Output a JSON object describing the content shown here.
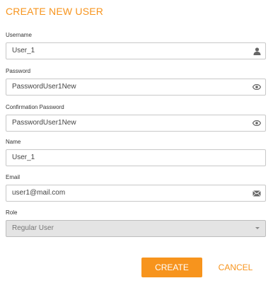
{
  "form": {
    "title": "CREATE NEW USER",
    "accent_color": "#f7941d",
    "fields": {
      "username": {
        "label": "Username",
        "value": "User_1",
        "icon": "user-icon"
      },
      "password": {
        "label": "Password",
        "value": "PasswordUser1New",
        "icon": "eye-icon"
      },
      "confirmation_password": {
        "label": "Confirmation Password",
        "value": "PasswordUser1New",
        "icon": "eye-icon"
      },
      "name": {
        "label": "Name",
        "value": "User_1"
      },
      "email": {
        "label": "Email",
        "value": "user1@mail.com",
        "icon": "envelope-icon"
      },
      "role": {
        "label": "Role",
        "value": "Regular User",
        "icon": "chevron-down-icon",
        "disabled": true
      }
    },
    "buttons": {
      "create_label": "CREATE",
      "cancel_label": "CANCEL"
    }
  }
}
